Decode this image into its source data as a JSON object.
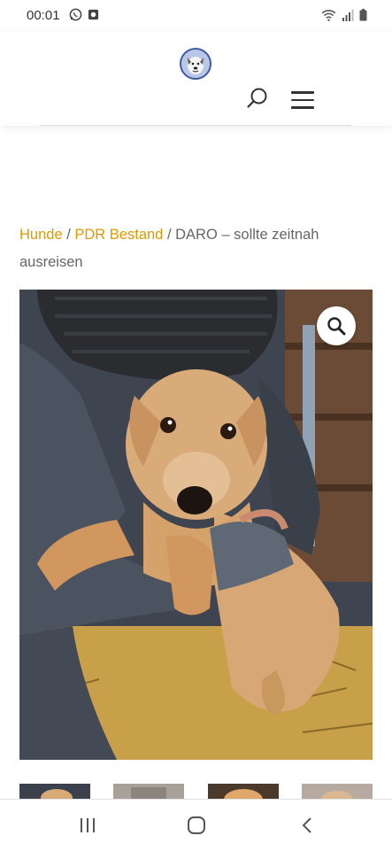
{
  "status_bar": {
    "time": "00:01",
    "left_icons": [
      "whatsapp-icon",
      "app-notification-icon"
    ],
    "right_icons": [
      "wifi-icon",
      "signal-icon",
      "battery-icon"
    ]
  },
  "header": {
    "logo_icon": "dog-logo-icon",
    "search_icon": "search-icon",
    "menu_icon": "hamburger-menu-icon"
  },
  "breadcrumb": {
    "crumb1": "Hunde",
    "sep1": " / ",
    "crumb2": "PDR Bestand",
    "sep2": " / ",
    "current": "DARO – sollte zeitnah ausreisen"
  },
  "product": {
    "zoom_icon": "magnifier-icon"
  },
  "colors": {
    "link": "#e09900",
    "text": "#666666"
  },
  "nav_bar": {
    "icons": [
      "recent-apps-icon",
      "home-icon",
      "back-icon"
    ]
  }
}
